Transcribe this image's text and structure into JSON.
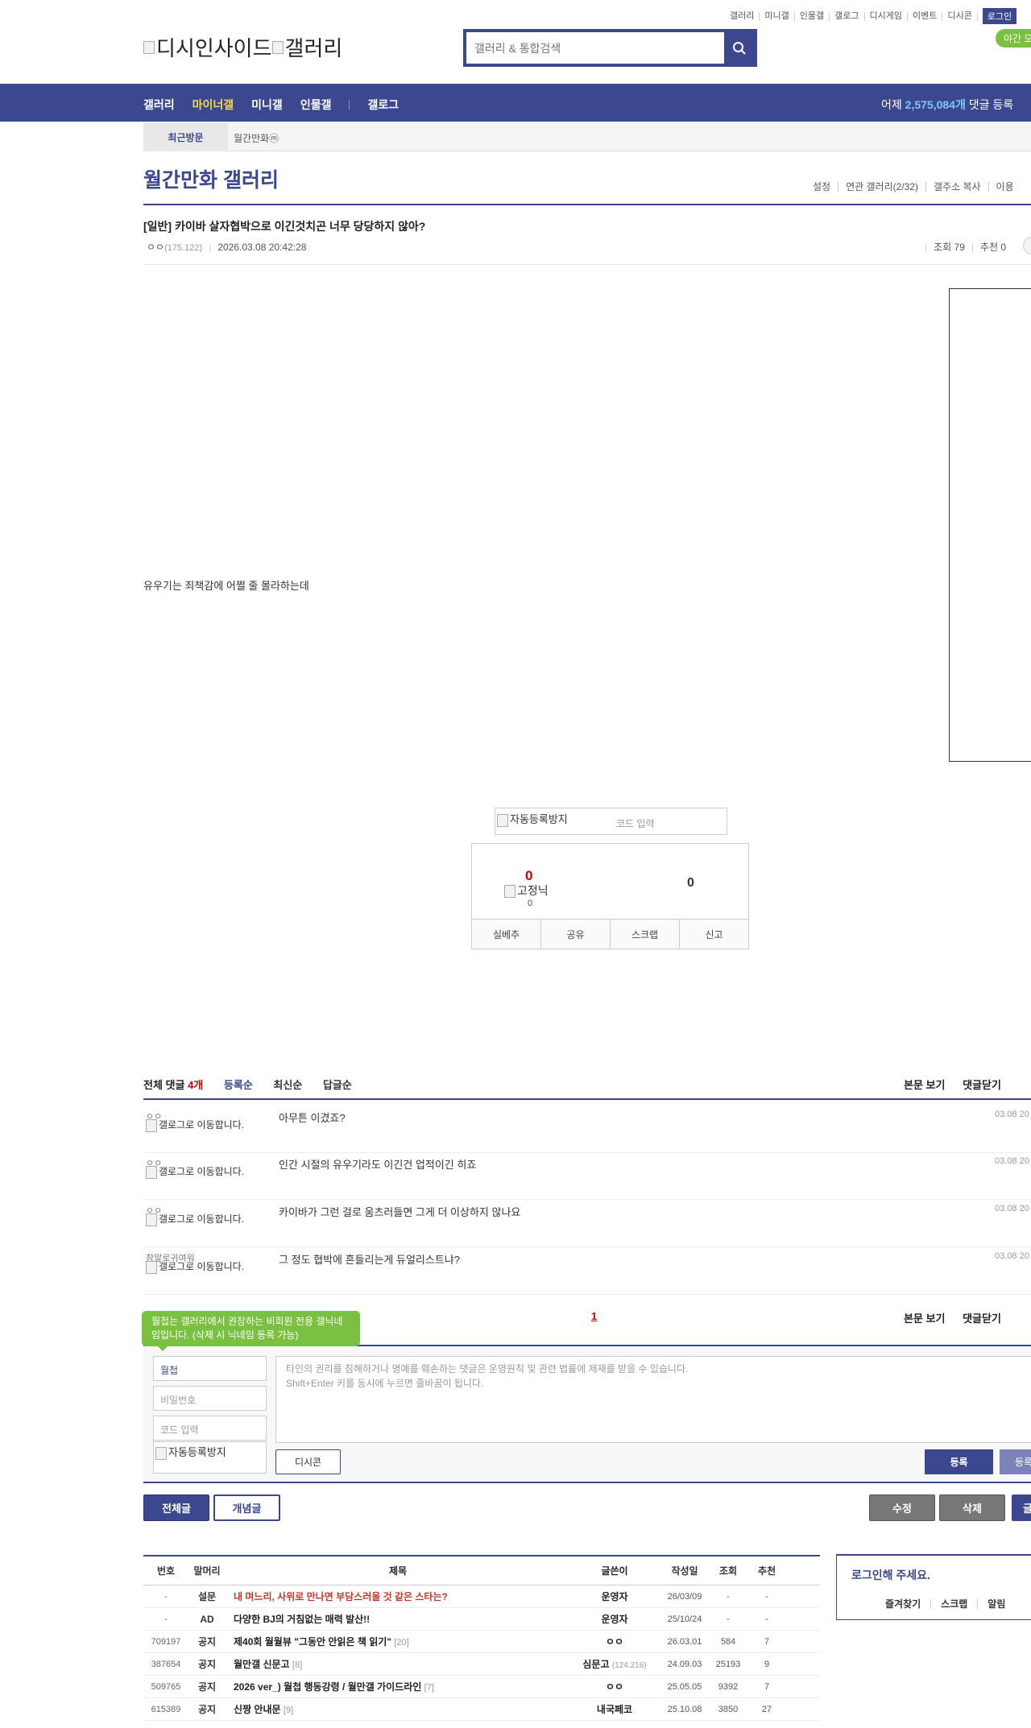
{
  "top_links": [
    "갤러리",
    "미니갤",
    "인물갤",
    "갤로그",
    "디시게임",
    "이벤트",
    "디시콘"
  ],
  "login_label": "로그인",
  "night_mode": "야간 모",
  "logo_alt": "디시인사이드",
  "logo_alt2": "갤러리",
  "search_placeholder": "갤러리 & 통합검색",
  "gnb": {
    "items": [
      "갤러리",
      "마이너갤",
      "미니갤",
      "인물갤",
      "갤로그"
    ],
    "stats_prefix": "어제",
    "stats_count": "2,575,084개",
    "stats_suffix": "댓글 등록"
  },
  "recent": {
    "title": "최근방문",
    "item": "월간만화ⓜ"
  },
  "gallery": {
    "title": "월간만화 갤러리",
    "menu": [
      "설정",
      "연관 갤러리(2/32)",
      "갤주소 복사",
      "이용"
    ]
  },
  "post": {
    "title": "[일반] 카이바 살자협박으로 이긴것치곤 너무 당당하지 않아?",
    "author": "ㅇㅇ",
    "ip": "(175.122)",
    "date": "2026.03.08 20:42:28",
    "views": "조회 79",
    "recommend": "추천 0",
    "body": "유우기는 죄책감에 어쩔 줄 몰라하는데"
  },
  "captcha": {
    "img_alt": "자동등록방지",
    "placeholder": "코드 입력"
  },
  "recommend_box": {
    "up_count": "0",
    "fix_nick_alt": "고정닉",
    "fix_count": "0",
    "down_count": "0",
    "buttons": [
      "실베추",
      "공유",
      "스크랩",
      "신고"
    ]
  },
  "comments": {
    "total_label": "전체 댓글",
    "total_count": "4개",
    "sort": [
      "등록순",
      "최신순",
      "답글순"
    ],
    "actions": [
      "본문 보기",
      "댓글닫기"
    ],
    "galog_alt": "갤로그로 이동합니다.",
    "items": [
      {
        "nick": "ㅇㅇ",
        "text": "아무튼 이겼죠?",
        "date": "03.08 20"
      },
      {
        "nick": "ㅇㅇ",
        "text": "인간 시절의 유우기라도 이긴건 업적이긴 히죠",
        "date": "03.08 20"
      },
      {
        "nick": "ㅇㅇ",
        "text": "카이바가 그런 걸로 움츠러들면 그게 더 이상하지 않나요",
        "date": "03.08 20"
      },
      {
        "nick": "참말로귀여워",
        "text": "그 정도 협박에 흔들리는게 듀얼리스트냐?",
        "date": "03.08 20"
      }
    ],
    "page": "1"
  },
  "write": {
    "tooltip": "월첩는 갤러리에서 권장하는 비회원 전용 갤닉네임입니다. (삭제 시 닉네임 등록 가능)",
    "nick_value": "월첩",
    "password_placeholder": "비밀번호",
    "code_placeholder": "코드 입력",
    "captcha_alt": "자동등록방지",
    "textarea_line1": "타인의 권리를 침해하거나 명예를 훼손하는 댓글은 운영원칙 및 관련 법률에 제재를 받을 수 있습니다.",
    "textarea_line2": "Shift+Enter 키를 동시에 누르면 줄바꿈이 됩니다.",
    "dccon": "디시콘",
    "register": "등록",
    "register2": "등록"
  },
  "bottom_buttons": {
    "all": "전체글",
    "concept": "개념글",
    "edit": "수정",
    "delete": "삭제",
    "write": "글"
  },
  "list": {
    "headers": [
      "번호",
      "말머리",
      "제목",
      "글쓴이",
      "작성일",
      "조회",
      "추천"
    ],
    "rows": [
      {
        "no": "-",
        "subject": "설문",
        "title": "내 며느리, 사위로 만나면 부담스러울 것 같은 스타는?",
        "reply": "",
        "writer": "운영자",
        "ip": "",
        "date": "26/03/09",
        "views": "-",
        "rec": "-"
      },
      {
        "no": "-",
        "subject": "AD",
        "title": "다양한 BJ의 거침없는 매력 발산!!",
        "reply": "",
        "writer": "운영자",
        "ip": "",
        "date": "25/10/24",
        "views": "-",
        "rec": "-"
      },
      {
        "no": "709197",
        "subject": "공지",
        "title": "제40회 월월뷰 \"그동안 안읽은 책 읽기\"",
        "reply": "[20]",
        "writer": "ㅇㅇ",
        "ip": "",
        "date": "26.03.01",
        "views": "584",
        "rec": "7"
      },
      {
        "no": "387654",
        "subject": "공지",
        "title": "월만갤 신문고",
        "reply": "[8]",
        "writer": "심문고",
        "ip": "(124.216)",
        "date": "24.09.03",
        "views": "25193",
        "rec": "9"
      },
      {
        "no": "509765",
        "subject": "공지",
        "title": "2026 ver_) 월첩 행동강령 / 월만갤 가이드라인",
        "reply": "[7]",
        "writer": "ㅇㅇ",
        "ip": "",
        "date": "25.05.05",
        "views": "9392",
        "rec": "7"
      },
      {
        "no": "615389",
        "subject": "공지",
        "title": "신짱 안내문",
        "reply": "[9]",
        "writer": "내국페코",
        "ip": "",
        "date": "25.10.08",
        "views": "3850",
        "rec": "27"
      }
    ]
  },
  "login_box": {
    "title": "로그인해 주세요.",
    "links": [
      "즐겨찾기",
      "스크랩",
      "알림"
    ]
  }
}
